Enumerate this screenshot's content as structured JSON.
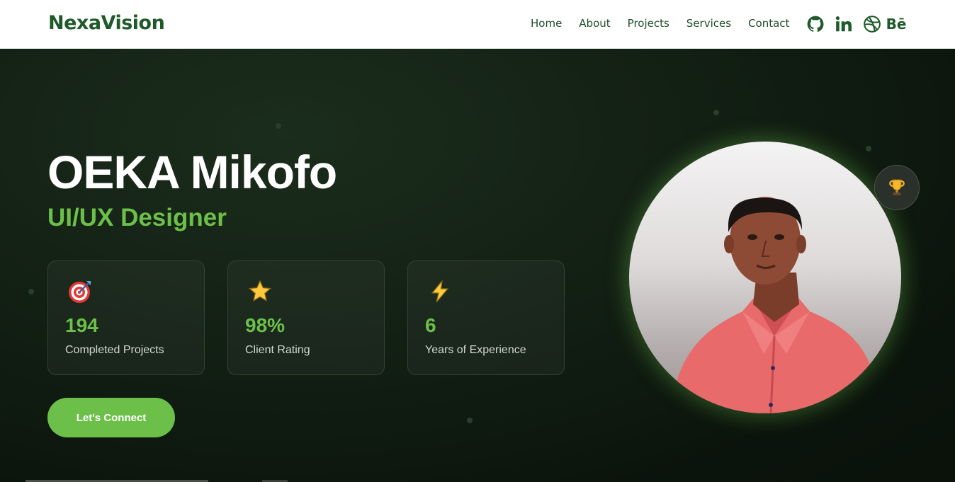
{
  "header": {
    "brand": "NexaVision",
    "nav": [
      "Home",
      "About",
      "Projects",
      "Services",
      "Contact"
    ],
    "social": [
      "github-icon",
      "linkedin-icon",
      "dribbble-icon",
      "behance-icon"
    ],
    "behance_label": "Bē"
  },
  "hero": {
    "name": "OEKA Mikofo",
    "role": "UI/UX Designer",
    "stats": [
      {
        "icon": "target-icon",
        "value": "194",
        "label": "Completed Projects"
      },
      {
        "icon": "star-icon",
        "value": "98%",
        "label": "Client Rating"
      },
      {
        "icon": "lightning-icon",
        "value": "6",
        "label": "Years of Experience"
      }
    ],
    "cta_label": "Let's Connect",
    "badge_icon": "trophy-icon"
  },
  "colors": {
    "brand_green": "#1f5a2a",
    "accent_green": "#6cc04a",
    "hero_bg": "#121f13"
  }
}
